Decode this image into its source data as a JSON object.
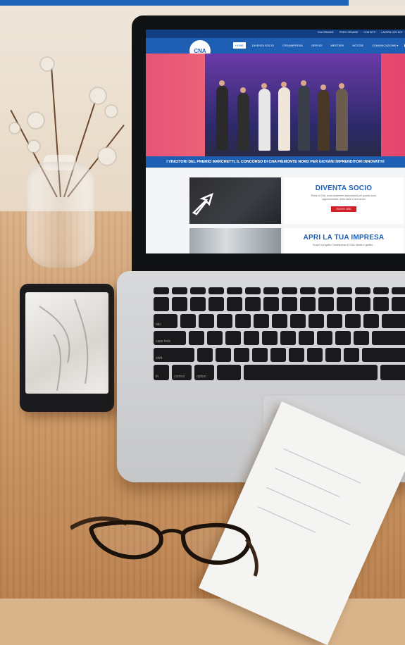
{
  "scene": {
    "description_items": [
      "laptop",
      "smartphone",
      "glass-vase-with-dried-flowers",
      "eyeglasses",
      "notebook"
    ]
  },
  "website": {
    "top_links": [
      "CNA GRANDE",
      "PREVI GRANDE",
      "CONTATTI",
      "LAVORA CON NOI"
    ],
    "logo_text": "CNA",
    "nav_items": [
      {
        "label": "HOME",
        "active": true
      },
      {
        "label": "DIVENTA SOCIO",
        "active": false
      },
      {
        "label": "CREAIMPRESA",
        "active": false
      },
      {
        "label": "SERVIZI",
        "active": false
      },
      {
        "label": "MESTIERI",
        "active": false
      },
      {
        "label": "NOTIZIE",
        "active": false
      },
      {
        "label": "COMUNICAZIONE ▾",
        "active": false
      }
    ],
    "hero_caption": "I VINCITORI DEL PREMIO MARCHETTI, IL CONCORSO DI CNA PIEMONTE NORD PER GIOVANI IMPRENDITORI INNOVATIVI",
    "cards": [
      {
        "title": "DIVENTA SOCIO",
        "description": "Entra in CNA: avrai sostenere associazioni per quanto sono rappresentativi, delle tutele e dei servizi",
        "button": "ISCRITI ORA"
      },
      {
        "title": "APRI LA TUA IMPRESA",
        "description": "Scopri il progetto Creaimpresa di CNA: ideato e gestito..."
      }
    ],
    "colors": {
      "primary": "#1f5fb3",
      "accent": "#d21e2b",
      "hero": "#e75378"
    }
  },
  "keyboard": {
    "row_labels": [
      "tab",
      "caps lock",
      "shift",
      "fn",
      "control",
      "option"
    ]
  }
}
